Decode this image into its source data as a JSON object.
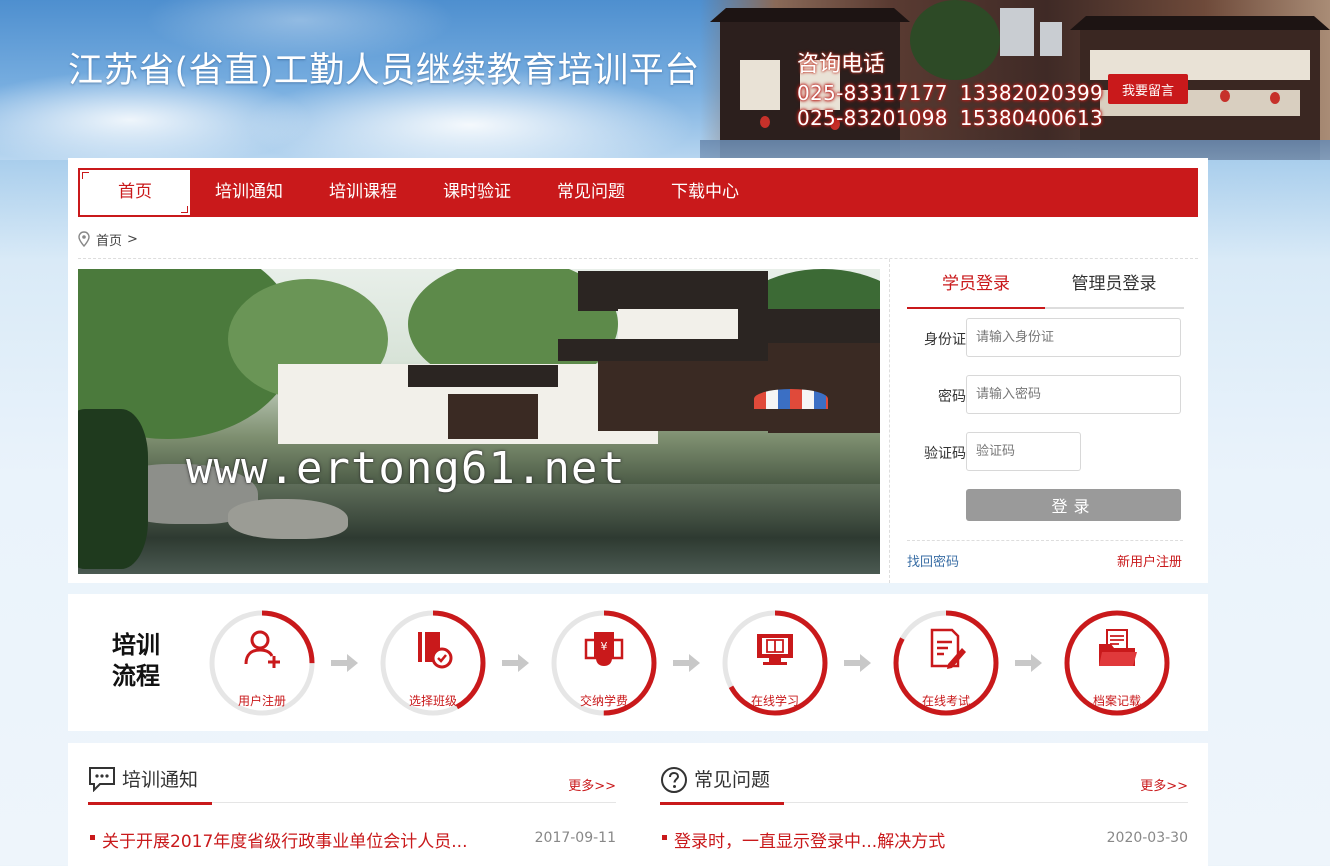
{
  "header": {
    "site_title": "江苏省(省直)工勤人员继续教育培训平台",
    "hotline_label": "咨询电话",
    "phones_row1": [
      "025-83317177",
      "13382020399"
    ],
    "phones_row2": [
      "025-83201098",
      "15380400613"
    ],
    "message_button": "我要留言"
  },
  "nav": {
    "items": [
      "首页",
      "培训通知",
      "培训课程",
      "课时验证",
      "常见问题",
      "下载中心"
    ],
    "active_index": 0
  },
  "breadcrumb": {
    "home": "首页",
    "separator": ">"
  },
  "banner": {
    "watermark": "www.ertong61.net"
  },
  "login": {
    "tabs": [
      "学员登录",
      "管理员登录"
    ],
    "active_tab": 0,
    "id_label": "身份证",
    "id_placeholder": "请输入身份证",
    "password_label": "密码",
    "password_placeholder": "请输入密码",
    "captcha_label": "验证码",
    "captcha_placeholder": "验证码",
    "submit": "登录",
    "forgot": "找回密码",
    "register": "新用户注册"
  },
  "process": {
    "title_line1": "培训",
    "title_line2": "流程",
    "steps": [
      {
        "label": "用户注册",
        "icon": "user-add-icon",
        "progress": 0.25
      },
      {
        "label": "选择班级",
        "icon": "class-select-icon",
        "progress": 0.42
      },
      {
        "label": "交纳学费",
        "icon": "pay-fee-icon",
        "progress": 0.5
      },
      {
        "label": "在线学习",
        "icon": "online-study-icon",
        "progress": 0.67
      },
      {
        "label": "在线考试",
        "icon": "online-exam-icon",
        "progress": 0.83
      },
      {
        "label": "档案记载",
        "icon": "archive-icon",
        "progress": 1.0
      }
    ]
  },
  "news": {
    "left": {
      "title": "培训通知",
      "more": "更多>>",
      "items": [
        {
          "title": "关于开展2017年度省级行政事业单位会计人员...",
          "date": "2017-09-11"
        }
      ]
    },
    "right": {
      "title": "常见问题",
      "more": "更多>>",
      "items": [
        {
          "title": "登录时，一直显示登录中...解决方式",
          "date": "2020-03-30"
        }
      ]
    }
  },
  "colors": {
    "brand_red": "#c9191b",
    "ring_gray": "#e6e6e6",
    "button_gray": "#9a9a9a"
  }
}
